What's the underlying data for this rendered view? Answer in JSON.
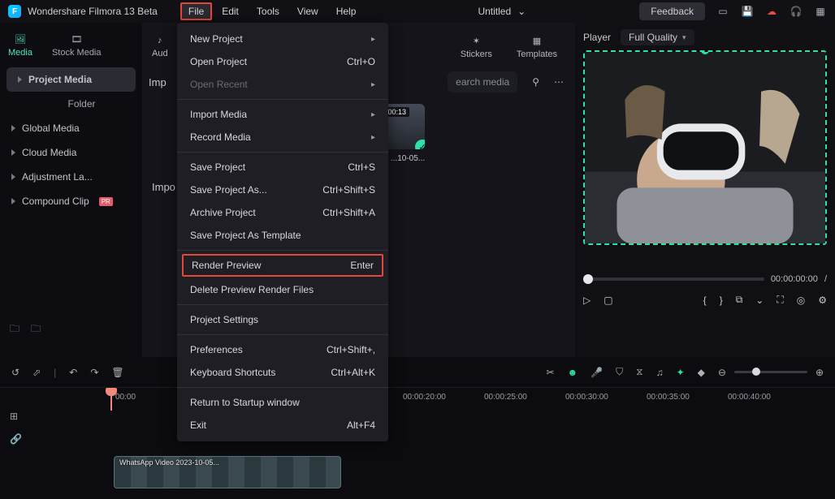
{
  "app": {
    "name": "Wondershare Filmora 13 Beta",
    "doc_title": "Untitled"
  },
  "menubar": [
    "File",
    "Edit",
    "Tools",
    "View",
    "Help"
  ],
  "titlebar_buttons": {
    "feedback": "Feedback"
  },
  "file_menu": {
    "groups": [
      [
        {
          "label": "New Project",
          "shortcut": "",
          "arrow": true
        },
        {
          "label": "Open Project",
          "shortcut": "Ctrl+O"
        },
        {
          "label": "Open Recent",
          "shortcut": "",
          "arrow": true,
          "disabled": true
        }
      ],
      [
        {
          "label": "Import Media",
          "shortcut": "",
          "arrow": true
        },
        {
          "label": "Record Media",
          "shortcut": "",
          "arrow": true
        }
      ],
      [
        {
          "label": "Save Project",
          "shortcut": "Ctrl+S"
        },
        {
          "label": "Save Project As...",
          "shortcut": "Ctrl+Shift+S"
        },
        {
          "label": "Archive Project",
          "shortcut": "Ctrl+Shift+A"
        },
        {
          "label": "Save Project As Template",
          "shortcut": ""
        }
      ],
      [
        {
          "label": "Render Preview",
          "shortcut": "Enter",
          "highlight": true
        },
        {
          "label": "Delete Preview Render Files",
          "shortcut": ""
        }
      ],
      [
        {
          "label": "Project Settings",
          "shortcut": ""
        }
      ],
      [
        {
          "label": "Preferences",
          "shortcut": "Ctrl+Shift+,"
        },
        {
          "label": "Keyboard Shortcuts",
          "shortcut": "Ctrl+Alt+K"
        }
      ],
      [
        {
          "label": "Return to Startup window",
          "shortcut": ""
        },
        {
          "label": "Exit",
          "shortcut": "Alt+F4"
        }
      ]
    ]
  },
  "top_tabs": [
    {
      "label": "Media",
      "active": true
    },
    {
      "label": "Stock Media"
    },
    {
      "label": "Aud"
    },
    {
      "label": "Stickers"
    },
    {
      "label": "Templates"
    }
  ],
  "sidebar": {
    "items": [
      {
        "label": "Project Media",
        "active": true
      },
      {
        "label": "Folder",
        "sub": true
      },
      {
        "label": "Global Media"
      },
      {
        "label": "Cloud Media"
      },
      {
        "label": "Adjustment La..."
      },
      {
        "label": "Compound Clip",
        "badge": "PR"
      }
    ]
  },
  "center": {
    "import_label": "Imp",
    "import_label2": "Impo",
    "search_placeholder": "earch media",
    "thumb": {
      "duration": ":00:13",
      "caption": "...10-05..."
    }
  },
  "player": {
    "title": "Player",
    "quality": "Full Quality",
    "time_current": "00:00:00:00",
    "time_sep": "/"
  },
  "timeline": {
    "ruler": [
      "00:00",
      "00:00:20:00",
      "00:00:25:00",
      "00:00:30:00",
      "00:00:35:00",
      "00:00:40:00"
    ],
    "clip_label": "WhatsApp Video 2023-10-05..."
  }
}
